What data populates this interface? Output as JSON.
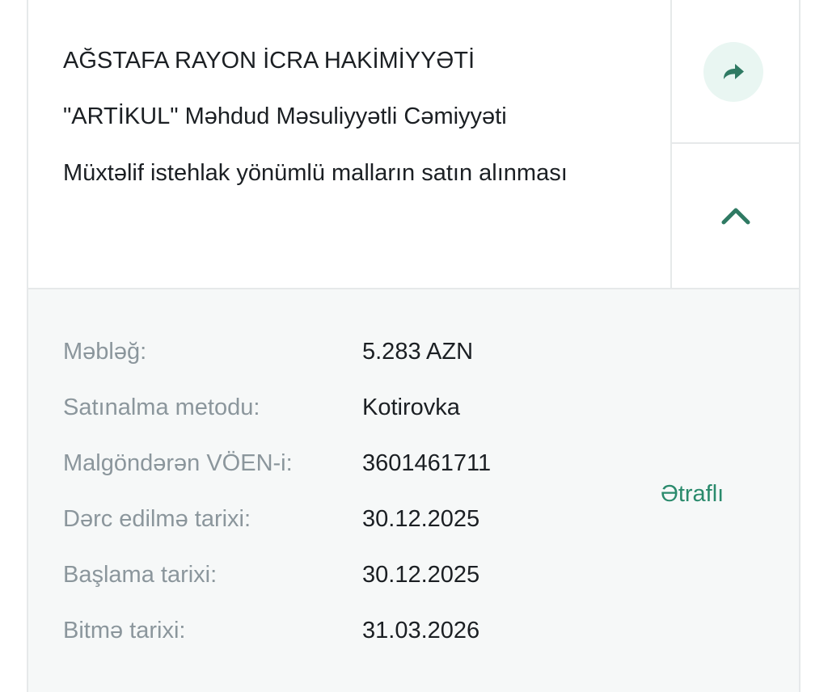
{
  "tender": {
    "organization": "AĞSTAFA RAYON İCRA HAKİMİYYƏTİ",
    "supplier": "\"ARTİKUL\" Məhdud Məsuliyyətli Cəmiyyəti",
    "subject": "Müxtəlif istehlak yönümlü malların satın alınması"
  },
  "actions": {
    "share_icon": "share-arrow-icon",
    "collapse_icon": "chevron-up-icon"
  },
  "details": {
    "rows": [
      {
        "label": "Məbləğ:",
        "value": "5.283 AZN"
      },
      {
        "label": "Satınalma metodu:",
        "value": "Kotirovka"
      },
      {
        "label": "Malgöndərən VÖEN-i:",
        "value": "3601461711"
      },
      {
        "label": "Dərc edilmə tarixi:",
        "value": "30.12.2025"
      },
      {
        "label": "Başlama tarixi:",
        "value": "30.12.2025"
      },
      {
        "label": "Bitmə tarixi:",
        "value": "31.03.2026"
      }
    ],
    "more_link": "Ətraflı"
  },
  "colors": {
    "accent": "#2a8a6c",
    "share_bg": "#e9f6f2",
    "details_bg": "#f6f8f8",
    "label_text": "#8b969c",
    "value_text": "#1b1f23",
    "border": "#e6e9ea"
  }
}
